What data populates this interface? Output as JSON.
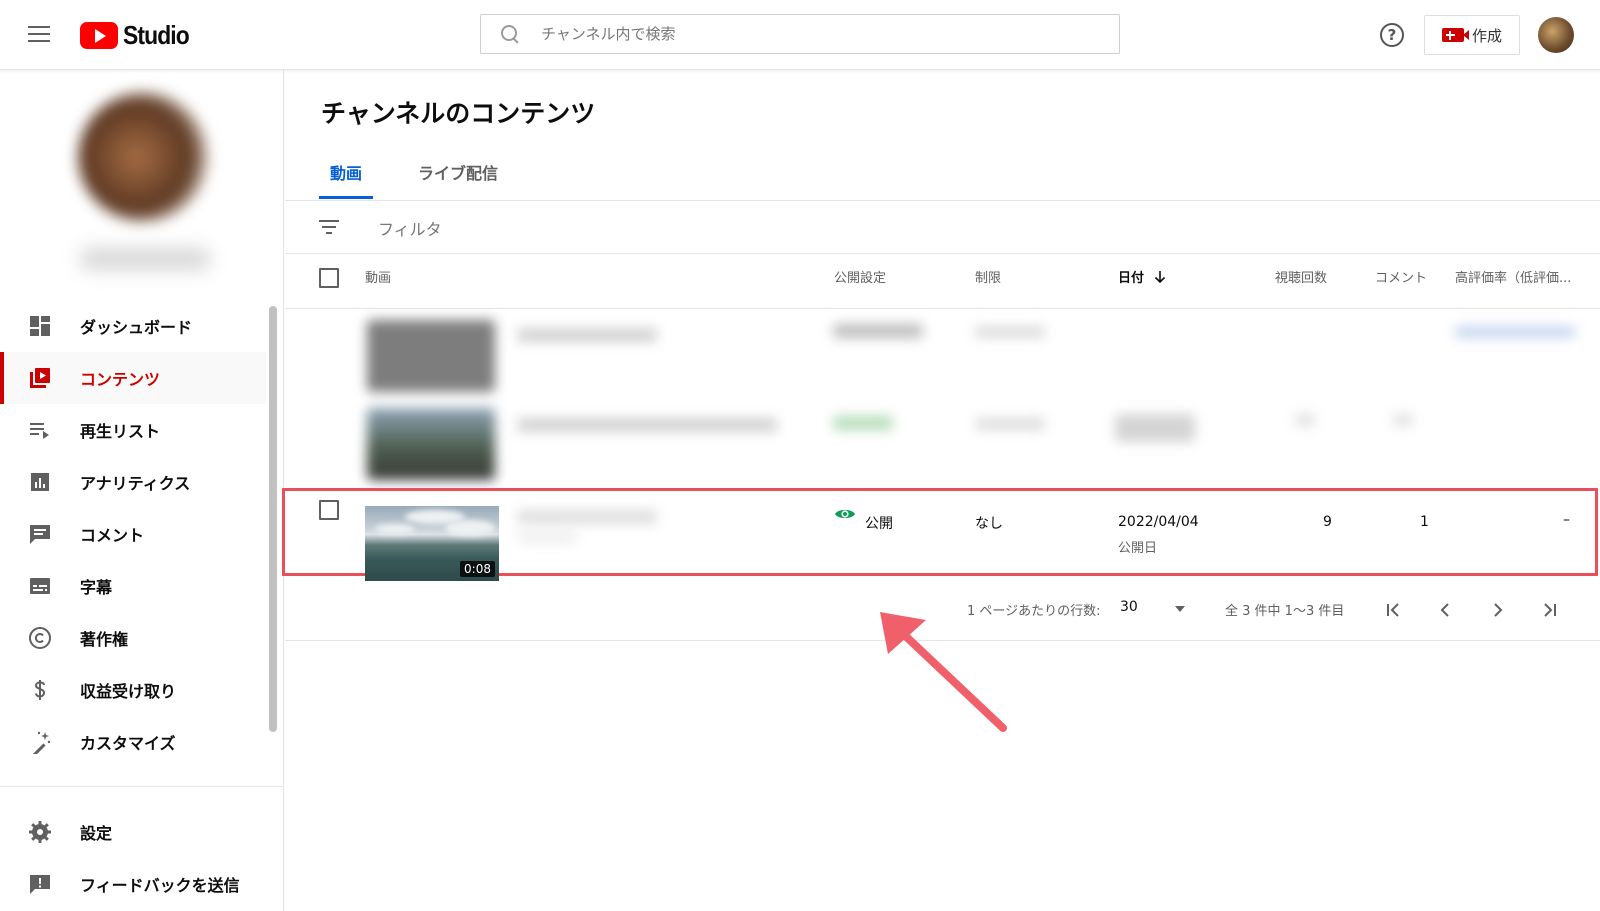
{
  "header": {
    "logo_text": "Studio",
    "search_placeholder": "チャンネル内で検索",
    "help_glyph": "?",
    "create_label": "作成"
  },
  "sidebar": {
    "items": [
      {
        "label": "ダッシュボード",
        "icon": "dashboard-icon"
      },
      {
        "label": "コンテンツ",
        "icon": "content-icon",
        "active": true
      },
      {
        "label": "再生リスト",
        "icon": "playlist-icon"
      },
      {
        "label": "アナリティクス",
        "icon": "analytics-icon"
      },
      {
        "label": "コメント",
        "icon": "comment-icon"
      },
      {
        "label": "字幕",
        "icon": "subtitles-icon"
      },
      {
        "label": "著作権",
        "icon": "copyright-icon"
      },
      {
        "label": "収益受け取り",
        "icon": "dollar-icon"
      },
      {
        "label": "カスタマイズ",
        "icon": "magic-wand-icon"
      }
    ],
    "bottom_items": [
      {
        "label": "設定",
        "icon": "gear-icon"
      },
      {
        "label": "フィードバックを送信",
        "icon": "feedback-icon"
      }
    ]
  },
  "main": {
    "title": "チャンネルのコンテンツ",
    "tabs": [
      {
        "label": "動画",
        "active": true
      },
      {
        "label": "ライブ配信",
        "active": false
      }
    ],
    "filter_placeholder": "フィルタ",
    "columns": {
      "video": "動画",
      "visibility": "公開設定",
      "restrictions": "制限",
      "date": "日付",
      "views": "視聴回数",
      "comments": "コメント",
      "likes": "高評価率（低評価..."
    },
    "highlighted_row": {
      "duration": "0:08",
      "visibility": "公開",
      "restrictions": "なし",
      "date": "2022/04/04",
      "date_sub": "公開日",
      "views": "9",
      "comments": "1",
      "likes": "–"
    },
    "pagination": {
      "rows_per_page_label": "1 ページあたりの行数:",
      "rows_per_page_value": "30",
      "range_text": "全 3 件中 1～3 件目"
    }
  },
  "colors": {
    "accent_red": "#cc0000",
    "tab_blue": "#065fd4",
    "public_green": "#0f9d58",
    "highlight_border": "#e8505b"
  }
}
